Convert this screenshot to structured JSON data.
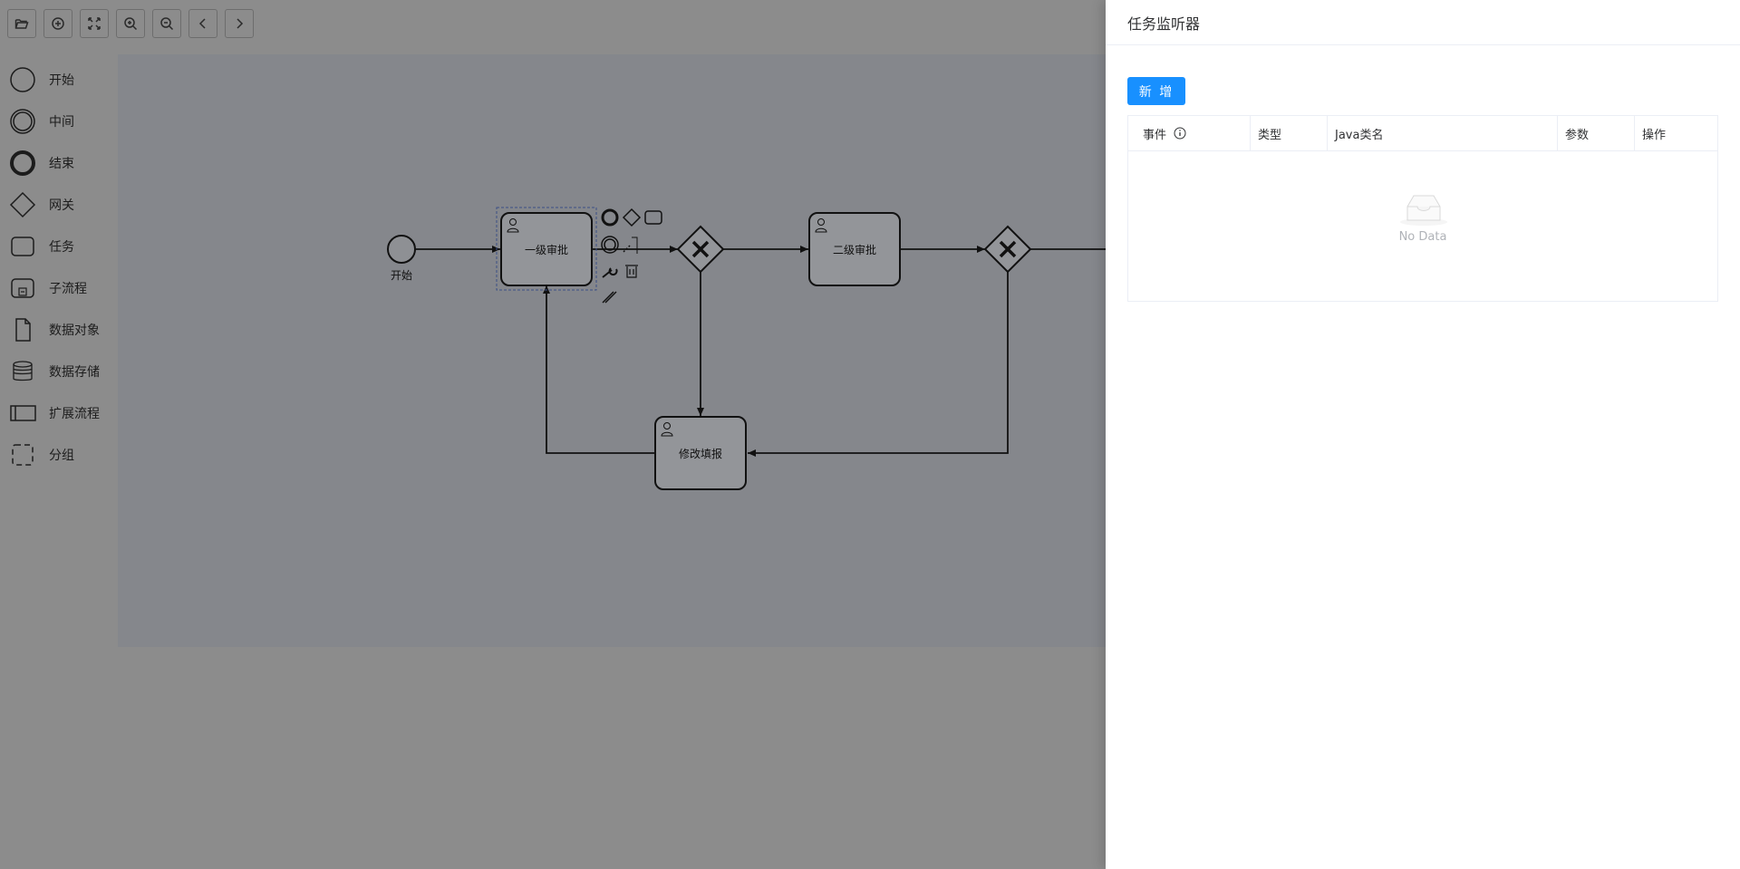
{
  "toolbar": {
    "buttons": [
      {
        "name": "open-file-button",
        "icon": "folder-open-icon"
      },
      {
        "name": "add-button",
        "icon": "plus-circle-icon"
      },
      {
        "name": "fit-view-button",
        "icon": "fit-screen-icon"
      },
      {
        "name": "zoom-in-button",
        "icon": "zoom-in-icon"
      },
      {
        "name": "zoom-out-button",
        "icon": "zoom-out-icon"
      },
      {
        "name": "undo-button",
        "icon": "chevron-left-icon"
      },
      {
        "name": "redo-button",
        "icon": "chevron-right-icon"
      }
    ]
  },
  "palette": {
    "items": [
      {
        "label": "开始",
        "icon": "start-event-icon"
      },
      {
        "label": "中间",
        "icon": "intermediate-event-icon"
      },
      {
        "label": "结束",
        "icon": "end-event-icon"
      },
      {
        "label": "网关",
        "icon": "gateway-icon"
      },
      {
        "label": "任务",
        "icon": "task-icon"
      },
      {
        "label": "子流程",
        "icon": "subprocess-icon"
      },
      {
        "label": "数据对象",
        "icon": "data-object-icon"
      },
      {
        "label": "数据存储",
        "icon": "data-store-icon"
      },
      {
        "label": "扩展流程",
        "icon": "pool-icon"
      },
      {
        "label": "分组",
        "icon": "group-icon"
      }
    ]
  },
  "diagram": {
    "start_label": "开始",
    "task1_label": "一级审批",
    "task2_label": "二级审批",
    "task3_label": "修改填报"
  },
  "drawer": {
    "title": "任务监听器",
    "add_button_label": "新 增",
    "columns": [
      "事件",
      "类型",
      "Java类名",
      "参数",
      "操作"
    ],
    "empty_text": "No Data"
  },
  "colors": {
    "primary": "#1890ff",
    "mask": "#8c8c8c",
    "canvas": "#85878c"
  }
}
